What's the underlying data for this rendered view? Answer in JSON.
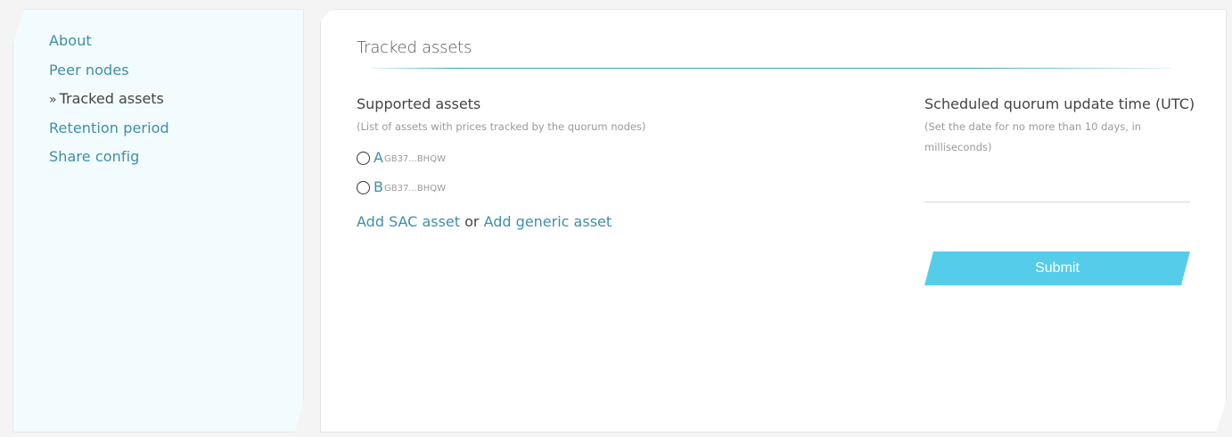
{
  "sidebar": {
    "items": [
      {
        "label": "About"
      },
      {
        "label": "Peer nodes"
      },
      {
        "label": "Tracked assets",
        "marker": "»"
      },
      {
        "label": "Retention period"
      },
      {
        "label": "Share config"
      }
    ]
  },
  "main": {
    "title": "Tracked assets",
    "supported": {
      "label": "Supported assets",
      "hint": "(List of assets with prices tracked by the quorum nodes)",
      "assets": [
        {
          "code": "A",
          "issuer": "GB37...BHQW"
        },
        {
          "code": "B",
          "issuer": "GB37...BHQW"
        }
      ],
      "add_sac": "Add SAC asset",
      "or": "or",
      "add_generic": "Add generic asset"
    },
    "schedule": {
      "label": "Scheduled quorum update time (UTC)",
      "hint": "(Set the date for no more than 10 days, in milliseconds)",
      "value": "",
      "submit_label": "Submit"
    }
  },
  "colors": {
    "link": "#3d8fa6",
    "accent_button": "#55cdea",
    "sidebar_bg": "#f2fbfd",
    "rule": "#3fa4ad"
  }
}
